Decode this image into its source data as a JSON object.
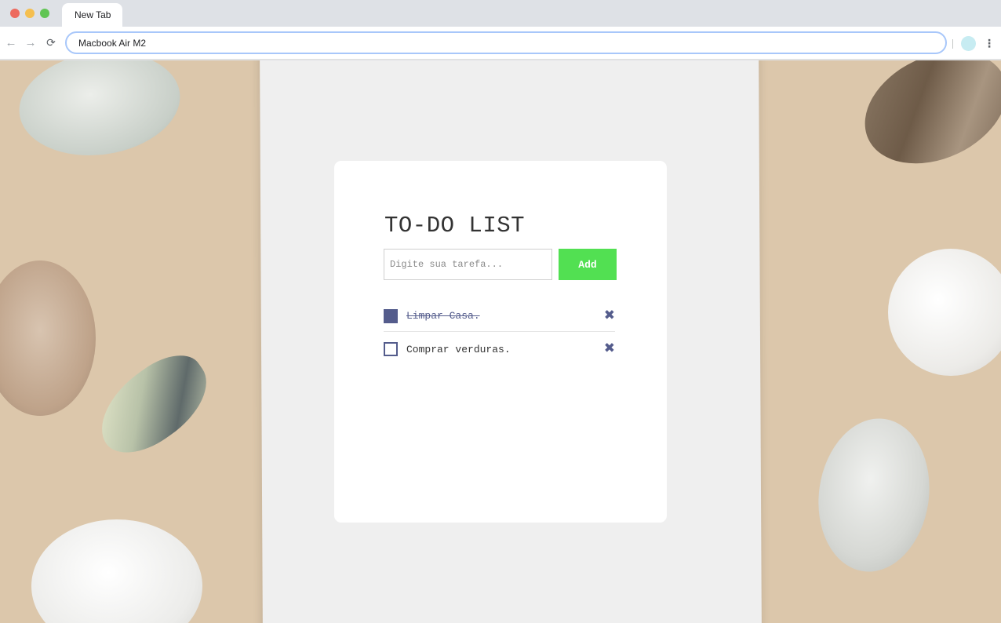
{
  "browser": {
    "tab_title": "New Tab",
    "address": "Macbook Air M2"
  },
  "todo": {
    "title": "TO-DO LIST",
    "input_placeholder": "Digite sua tarefa...",
    "add_label": "Add",
    "tasks": [
      {
        "label": "Limpar Casa.",
        "done": true
      },
      {
        "label": "Comprar verduras.",
        "done": false
      }
    ]
  },
  "colors": {
    "accent": "#545c8c",
    "add_button": "#52e052"
  }
}
